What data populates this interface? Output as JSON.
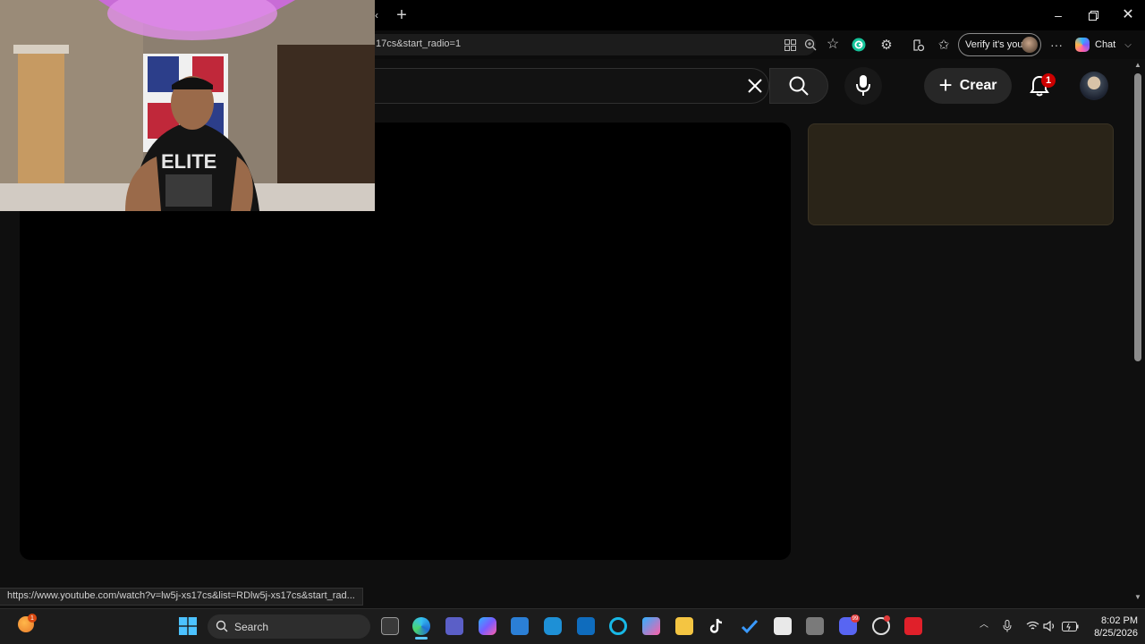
{
  "browser": {
    "url_fragment": "17cs&start_radio=1",
    "verify_label": "Verify it's you",
    "chat_label": "Chat",
    "status_url": "https://www.youtube.com/watch?v=lw5j-xs17cs&list=RDlw5j-xs17cs&start_rad..."
  },
  "youtube": {
    "create_label": "Crear",
    "notification_count": "1"
  },
  "taskbar": {
    "search_label": "Search",
    "time": "8:02 PM",
    "date": "8/25/2026"
  },
  "colors": {
    "notification_badge": "#cc0000",
    "side_card": "#2a2418",
    "scroll_thumb": "#8c8c8c"
  }
}
